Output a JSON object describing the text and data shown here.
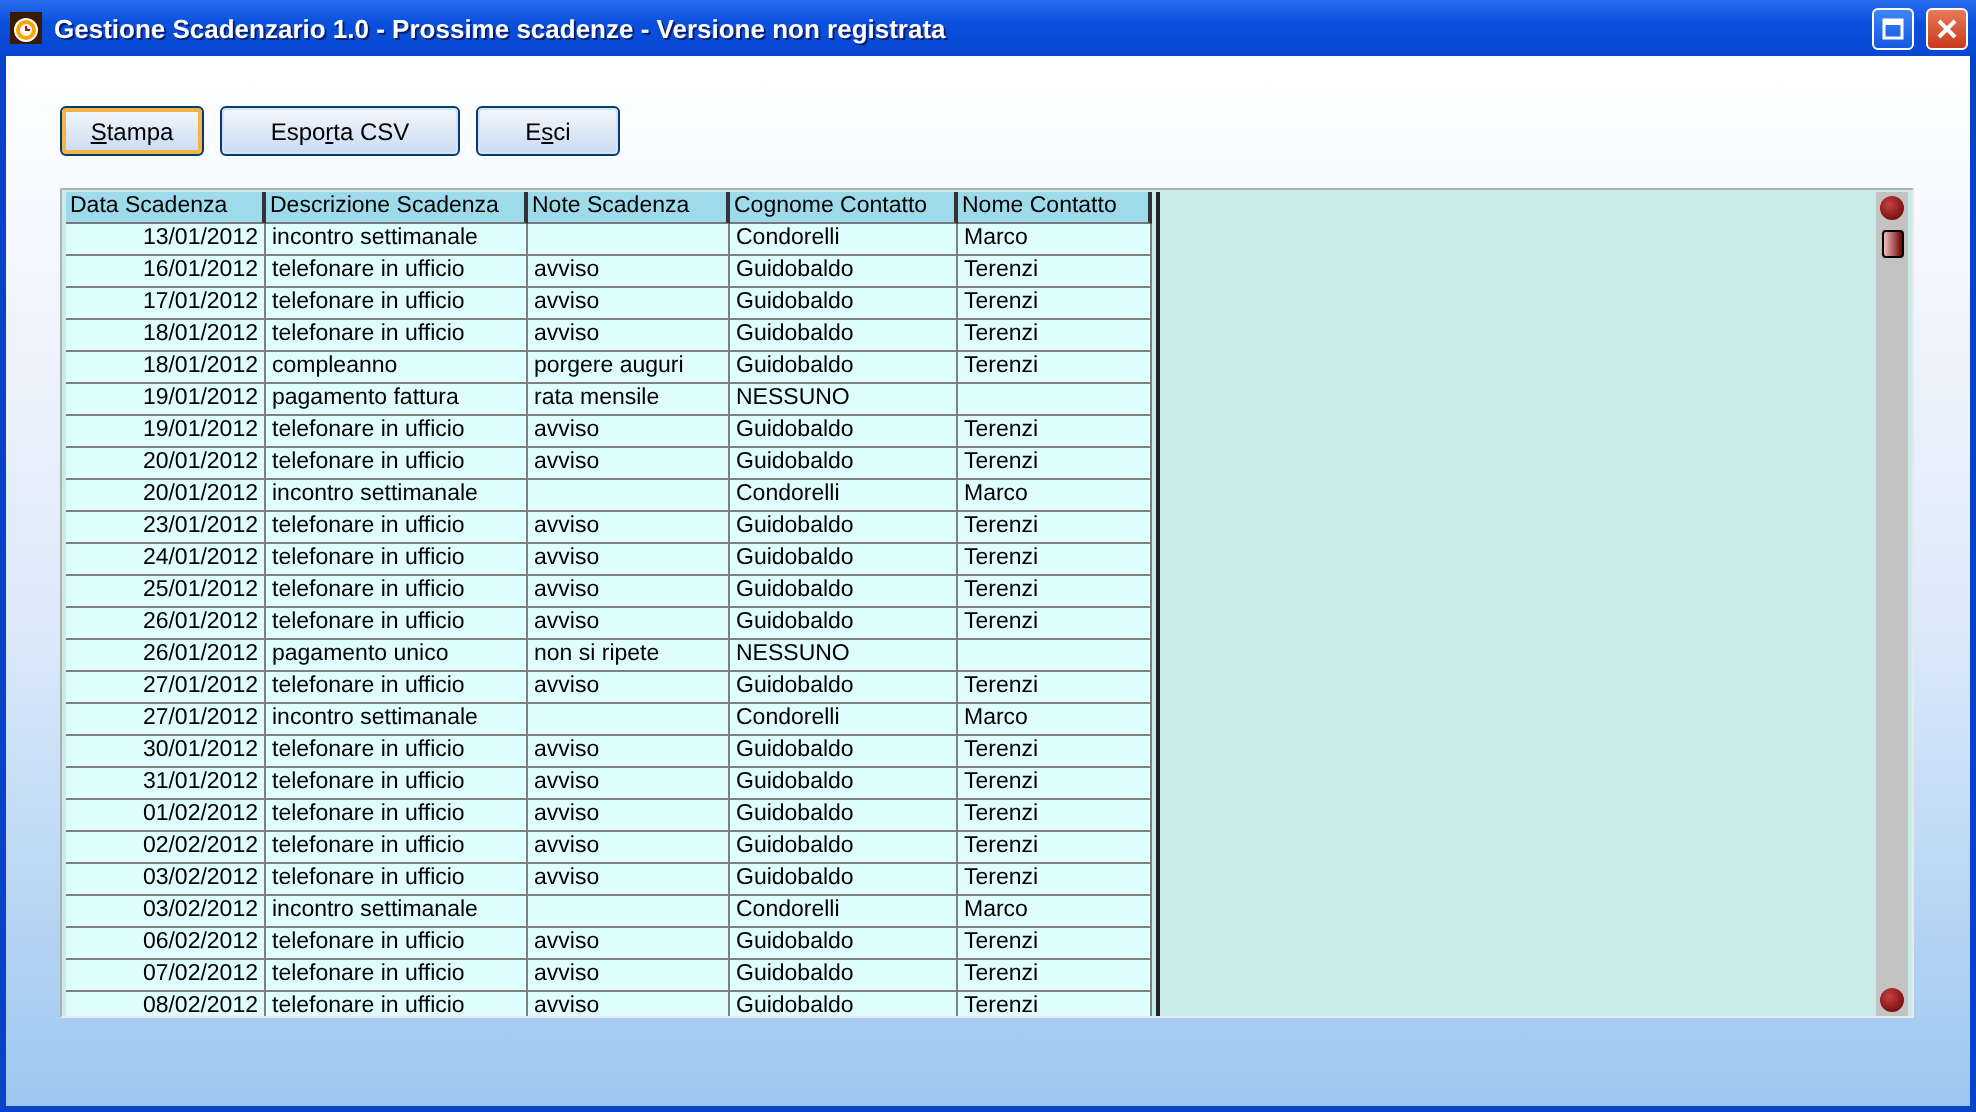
{
  "window": {
    "title": "Gestione Scadenzario 1.0 - Prossime scadenze - Versione non registrata"
  },
  "buttons": [
    {
      "key": "S",
      "post": "tampa",
      "focused": true
    },
    {
      "pre": "Espo",
      "key": "r",
      "post": "ta CSV",
      "focused": false
    },
    {
      "pre": "E",
      "key": "s",
      "post": "ci",
      "focused": false
    }
  ],
  "table": {
    "columns": [
      "Data Scadenza",
      "Descrizione Scadenza",
      "Note Scadenza",
      "Cognome Contatto",
      "Nome Contatto"
    ],
    "rows": [
      [
        "13/01/2012",
        "incontro settimanale",
        "",
        "Condorelli",
        "Marco"
      ],
      [
        "16/01/2012",
        "telefonare in ufficio",
        "avviso",
        "Guidobaldo",
        "Terenzi"
      ],
      [
        "17/01/2012",
        "telefonare in ufficio",
        "avviso",
        "Guidobaldo",
        "Terenzi"
      ],
      [
        "18/01/2012",
        "telefonare in ufficio",
        "avviso",
        "Guidobaldo",
        "Terenzi"
      ],
      [
        "18/01/2012",
        "compleanno",
        "porgere auguri",
        "Guidobaldo",
        "Terenzi"
      ],
      [
        "19/01/2012",
        "pagamento fattura",
        "rata mensile",
        "NESSUNO",
        ""
      ],
      [
        "19/01/2012",
        "telefonare in ufficio",
        "avviso",
        "Guidobaldo",
        "Terenzi"
      ],
      [
        "20/01/2012",
        "telefonare in ufficio",
        "avviso",
        "Guidobaldo",
        "Terenzi"
      ],
      [
        "20/01/2012",
        "incontro settimanale",
        "",
        "Condorelli",
        "Marco"
      ],
      [
        "23/01/2012",
        "telefonare in ufficio",
        "avviso",
        "Guidobaldo",
        "Terenzi"
      ],
      [
        "24/01/2012",
        "telefonare in ufficio",
        "avviso",
        "Guidobaldo",
        "Terenzi"
      ],
      [
        "25/01/2012",
        "telefonare in ufficio",
        "avviso",
        "Guidobaldo",
        "Terenzi"
      ],
      [
        "26/01/2012",
        "telefonare in ufficio",
        "avviso",
        "Guidobaldo",
        "Terenzi"
      ],
      [
        "26/01/2012",
        "pagamento unico",
        "non si ripete",
        "NESSUNO",
        ""
      ],
      [
        "27/01/2012",
        "telefonare in ufficio",
        "avviso",
        "Guidobaldo",
        "Terenzi"
      ],
      [
        "27/01/2012",
        "incontro settimanale",
        "",
        "Condorelli",
        "Marco"
      ],
      [
        "30/01/2012",
        "telefonare in ufficio",
        "avviso",
        "Guidobaldo",
        "Terenzi"
      ],
      [
        "31/01/2012",
        "telefonare in ufficio",
        "avviso",
        "Guidobaldo",
        "Terenzi"
      ],
      [
        "01/02/2012",
        "telefonare in ufficio",
        "avviso",
        "Guidobaldo",
        "Terenzi"
      ],
      [
        "02/02/2012",
        "telefonare in ufficio",
        "avviso",
        "Guidobaldo",
        "Terenzi"
      ],
      [
        "03/02/2012",
        "telefonare in ufficio",
        "avviso",
        "Guidobaldo",
        "Terenzi"
      ],
      [
        "03/02/2012",
        "incontro settimanale",
        "",
        "Condorelli",
        "Marco"
      ],
      [
        "06/02/2012",
        "telefonare in ufficio",
        "avviso",
        "Guidobaldo",
        "Terenzi"
      ],
      [
        "07/02/2012",
        "telefonare in ufficio",
        "avviso",
        "Guidobaldo",
        "Terenzi"
      ],
      [
        "08/02/2012",
        "telefonare in ufficio",
        "avviso",
        "Guidobaldo",
        "Terenzi"
      ]
    ]
  }
}
